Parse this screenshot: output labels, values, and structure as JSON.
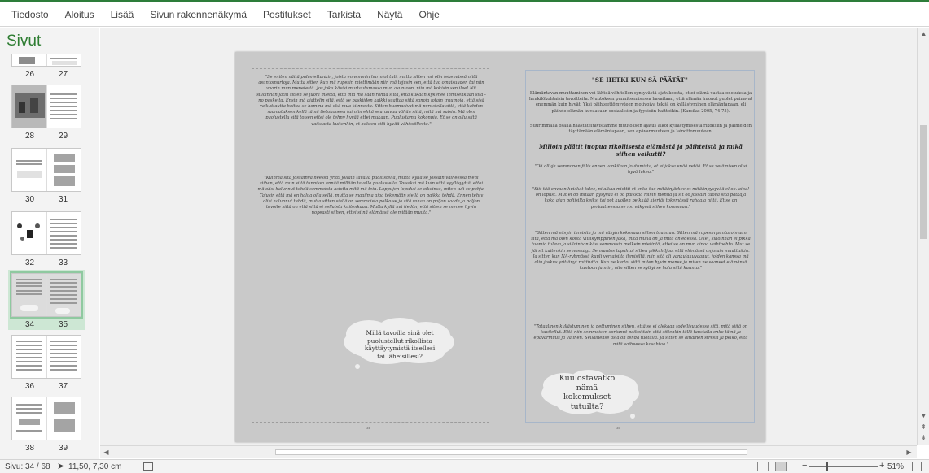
{
  "ribbon": {
    "tabs": [
      "Tiedosto",
      "Aloitus",
      "Lisää",
      "Sivun rakennenäkymä",
      "Postitukset",
      "Tarkista",
      "Näytä",
      "Ohje"
    ]
  },
  "pages_pane": {
    "title": "Sivut",
    "spreads": [
      {
        "left": "26",
        "right": "27"
      },
      {
        "left": "28",
        "right": "29"
      },
      {
        "left": "30",
        "right": "31"
      },
      {
        "left": "32",
        "right": "33"
      },
      {
        "left": "34",
        "right": "35"
      },
      {
        "left": "36",
        "right": "37"
      },
      {
        "left": "38",
        "right": "39"
      }
    ],
    "selected_spread": "34-35"
  },
  "document": {
    "left_page": {
      "quote1": "\"Se eniten näitä pulaviettunkin, joista ennemmin harmiot tuli, mutta sitten mä olin tekemässä niitä asuntomurtoja. Mutta sitten kun mä rupesin miettimään niin mä tajusin sen, että tuo omaisuuden tai niin vaarin mun menetettä. Jos joku kävisi murtautumassa mun asuntoon, niin mä kokisin sen ilee! Nii silloinhan jätin sitten se juoni miettä, että miä mä saan rahaa siitä, että kukaan kykenee ihmisenkään sitä - no paskeita. Ensin mä ajattelin sitä, että se paskiiden kaikki saattaa siitä sanoja jotain traumoja, että sisä vaikuttautta hoitaa se homma mä ekä mua kiinnosta. Sitten huomasivat mä perustella siitä, että kahden raamatuksen kellä tämä tietokoneen tai niin ehkä seuraavaa vähän siitä, mitä mä saisin. Mä olen puolustellu sitä toisen ettei ole tehny hyvää ettei mukaan. Pualustamu kokonpia. Et se on ollu siitä vaikeasta kuitenkin, et hoksen sitä hyvää vähissöllesta.\"",
      "quote2": "\"Kuinmä sitä jossainvaiheessa yritti jollain tavalla puolustella, mutta kyllä se jossain vaiheessa meni siihen, että mun siitä tunnissa ennää millään tavalla puolustella. Toisaksi mä kuin siitä syyllisyyttä, ettei mä olisi halunnut tehdä semmoista asioita mitä mä tein. Loppujen lopuksi se oikeinsa, miten tuli se pohja. Tajusin että mä en halua olla sellä, mutta se maailma ajaa tekemään siellä on paikka tehdä. Ennen tehty olisi halunnut tehdä, mutta sitten siellä on semmoista pelko se ja sitä rahaa on paljon saada ja paljon tavoite siitä on että siitä ei sellaista kuitenkaan. Mutta kyllä mä tiedän, että sitten se menee hyvin nopeasti siihen, ettei siinä elämässä ole mitään muuta.\"",
      "cloud": "Millä tavoilla sinä olet puolustellut rikollista käyttäytymistä itsellesi tai läheisillesi?",
      "page_number": "34"
    },
    "right_page": {
      "title": "\"SE HETKI KUN SÄ PÄÄTÄT\"",
      "intro1": "Elämäntavan muuttaminen voi lähteä vähitellen syntyvästä ajatuksesta, ettei elämä vastaa odotuksia ja henkilökohtaisia tavoitteita. Muutoksen punnitsemisessa havaitaan, että elämän huonot puolet painavat enemmän kuin hyvät. Yksi päihteettömyyteen motivoiva tekijä on kyllästyminen elämäntapaan, eli päihde-elämän kuvaavaan sosiaalisiin ja fyysisiin haittoihin. (Karsilas 2005, 74-75).",
      "intro2": "Suurimmalla osalla haastateltavistamme muutoksen ajatus alkoi kyllästymisestä rikoksiin ja päihteiden täyttämään elämäntapaan, sen epävarmuuteen ja lainottomuuteen.",
      "subtitle": "Milloin päätit luopua rikollisesta elämästä ja päihteistä ja mikä siihen vaikutti?",
      "q1": "\"Oli olluja semmonen fiilis ennen vankilaan joutumista, et ei jaksa enää vetää. Et se vetämisen olisi hyvä lukea.\"",
      "q2": "\"Siit tää onvaan kuiskat tulee, ni alkaa miettii et onko tuo mitäänjärkee et mitäänpysyvää el oo. aina! on lopust. Mut ei oo mitään pysyvää ei oo paikkaa mihin mennä ja sit oo jossain tuolla sitä pätkäjä koko ajan poliisilta keiksi tai oot kuollen pelkkää kiertät tokemässä rahaaja niitä. Et se on periaatteessa se ns. väkymä siihen kommaan.\"",
      "q3": "\"Sitten mä väsyin ihmisiin ja mä väsyin kokonaan siihen touhuun. Sitten mä rupesin puntaroimaan sitä, että mä olen kohta viisikymppinen jäkä, mitä mulla on ja mitä on edessä. Okei, silloinhan ei pikkä tuomio tuleva ja silloinhan käsi semmoisia melkein mietintä, ettei se on mun ainoa vaihtoehto. Mut se jäi sit kuitenkin se nostalgi. Se muutos tapahtui sitten pikkuhiljaa, että elämässä onjotain muuttuikin. Ja sitten kun NA-ryhmässä kuuli vertaisilta ihmisiltä, niin sitä oli vankujakuvaanut, joiden kanssa mä olin joskus yrittänyt raittiutta. Kun ne kertoi siitä miten hyvin menee ja miten ne saaneet elämänsä kuntoon ja niin, niin sitten se syttyi se halu siitä kuuntu.\"",
      "q4": "\"Totaalinen kyllästyminen ja pettyminen siihen, että se ei olekaan todellisuudessa sitä, mitä siitä on kuvitellut. Että niin semmoisen sortunut paikoittain että sittenkin tällä taustalla onko tämä ja epävarmuus ja välinen. Sellainense asia on tehdä tuotalla. Ja sitten se ainainen stressi ja pelko, että mitä vaiheessa kosahtaa.\"",
      "cloud": "Kuulostavatko nämä kokemukset tutuilta?",
      "page_number": "35"
    }
  },
  "status": {
    "page": "Sivu: 34 / 68",
    "position": "11,50, 7,30 cm",
    "zoom": "51%"
  },
  "colors": {
    "accent": "#2d7d3a",
    "pane_title": "#2e7d32",
    "selected_thumb": "#cde7d4",
    "page_gray": "#c9c9c9"
  }
}
